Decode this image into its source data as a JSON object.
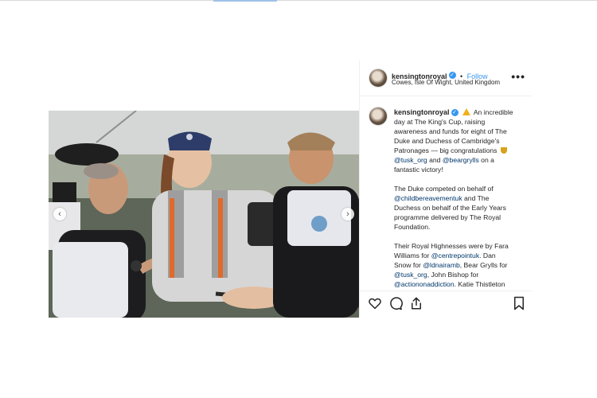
{
  "post": {
    "username": "kensingtonroyal",
    "follow_label": "Follow",
    "separator": "•",
    "location": "Cowes, Isle Of Wight, United Kingdom",
    "more_label": "•••",
    "caption": {
      "p1_a": "An incredible day at The King's Cup, raising awareness and funds for eight of The Duke and Duchess of Cambridge's Patronages — big congratulations",
      "p1_m1": "@tusk_org",
      "p1_and": " and ",
      "p1_m2": "@beargrylls",
      "p1_b": " on a fantastic victory!",
      "p2_a": "The Duke competed on behalf of ",
      "p2_m1": "@childbereavementuk",
      "p2_b": " and The Duchess on behalf of the Early Years programme delivered by The Royal Foundation.",
      "p3_a": "Their Royal Highnesses were by Fara Williams for ",
      "p3_m1": "@centrepointuk",
      "p3_b": ". Dan Snow for ",
      "p3_m2": "@ldnairamb",
      "p3_c": ", Bear Grylls for ",
      "p3_m3": "@tusk_org",
      "p3_d": ", John Bishop for ",
      "p3_m4": "@actiononaddiction",
      "p3_e": ". Katie Thistleton"
    },
    "icons": {
      "like": "heart-icon",
      "comment": "comment-icon",
      "share": "share-icon",
      "save": "bookmark-icon"
    }
  }
}
